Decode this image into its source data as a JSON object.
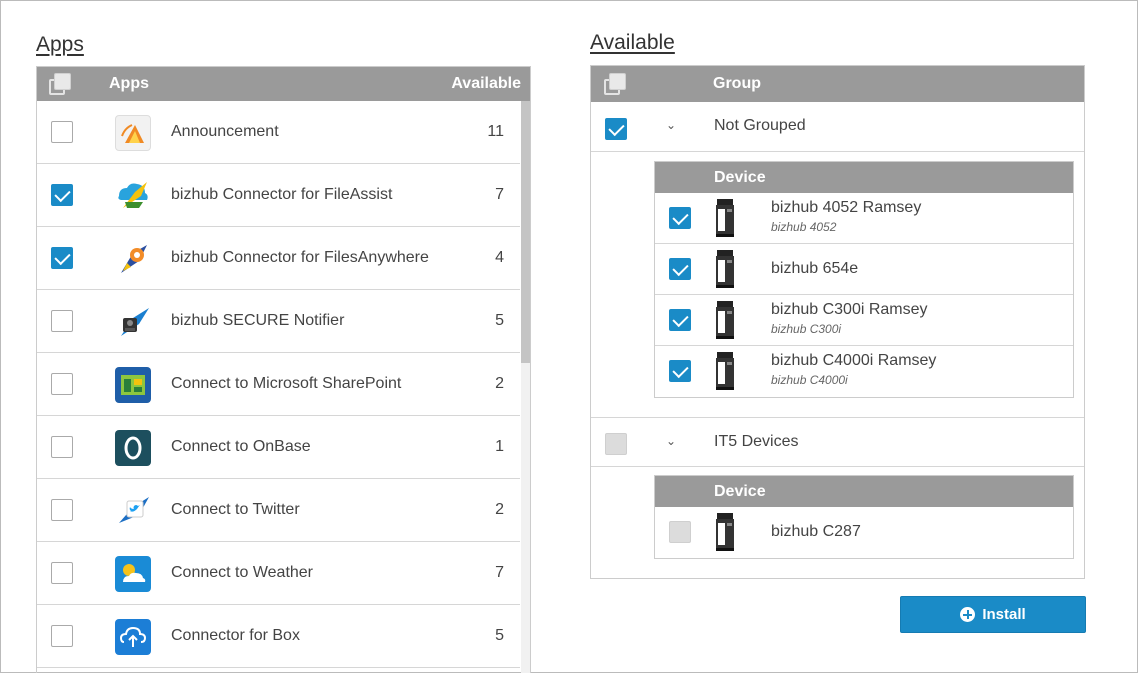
{
  "apps_section": {
    "title": "Apps",
    "header": {
      "col_apps": "Apps",
      "col_available": "Available"
    },
    "rows": [
      {
        "name": "Announcement",
        "count": "11",
        "checked": false,
        "icon": "announcement-icon"
      },
      {
        "name": "bizhub Connector for FileAssist",
        "count": "7",
        "checked": true,
        "icon": "fileassist-icon"
      },
      {
        "name": "bizhub Connector for FilesAnywhere",
        "count": "4",
        "checked": true,
        "icon": "filesanywhere-icon"
      },
      {
        "name": "bizhub SECURE Notifier",
        "count": "5",
        "checked": false,
        "icon": "secure-notifier-icon"
      },
      {
        "name": "Connect to Microsoft SharePoint",
        "count": "2",
        "checked": false,
        "icon": "sharepoint-icon"
      },
      {
        "name": "Connect to OnBase",
        "count": "1",
        "checked": false,
        "icon": "onbase-icon"
      },
      {
        "name": "Connect to Twitter",
        "count": "2",
        "checked": false,
        "icon": "twitter-icon"
      },
      {
        "name": "Connect to Weather",
        "count": "7",
        "checked": false,
        "icon": "weather-icon"
      },
      {
        "name": "Connector for Box",
        "count": "5",
        "checked": false,
        "icon": "box-icon"
      }
    ]
  },
  "available_section": {
    "title": "Available",
    "header": {
      "col_group": "Group"
    },
    "groups": [
      {
        "name": "Not Grouped",
        "checked": true,
        "device_header": "Device",
        "devices": [
          {
            "name": "bizhub 4052 Ramsey",
            "model": "bizhub 4052",
            "checked": true
          },
          {
            "name": "bizhub 654e",
            "model": "",
            "checked": true
          },
          {
            "name": "bizhub C300i Ramsey",
            "model": "bizhub C300i",
            "checked": true
          },
          {
            "name": "bizhub C4000i Ramsey",
            "model": "bizhub C4000i",
            "checked": true
          }
        ]
      },
      {
        "name": "IT5 Devices",
        "checked": false,
        "device_header": "Device",
        "devices": [
          {
            "name": "bizhub C287",
            "model": "",
            "checked": false
          }
        ]
      }
    ]
  },
  "install_button": {
    "label": "Install",
    "icon": "plus-circle-icon"
  },
  "colors": {
    "accent": "#1a8bc7",
    "header_gray": "#9a9a9a"
  }
}
